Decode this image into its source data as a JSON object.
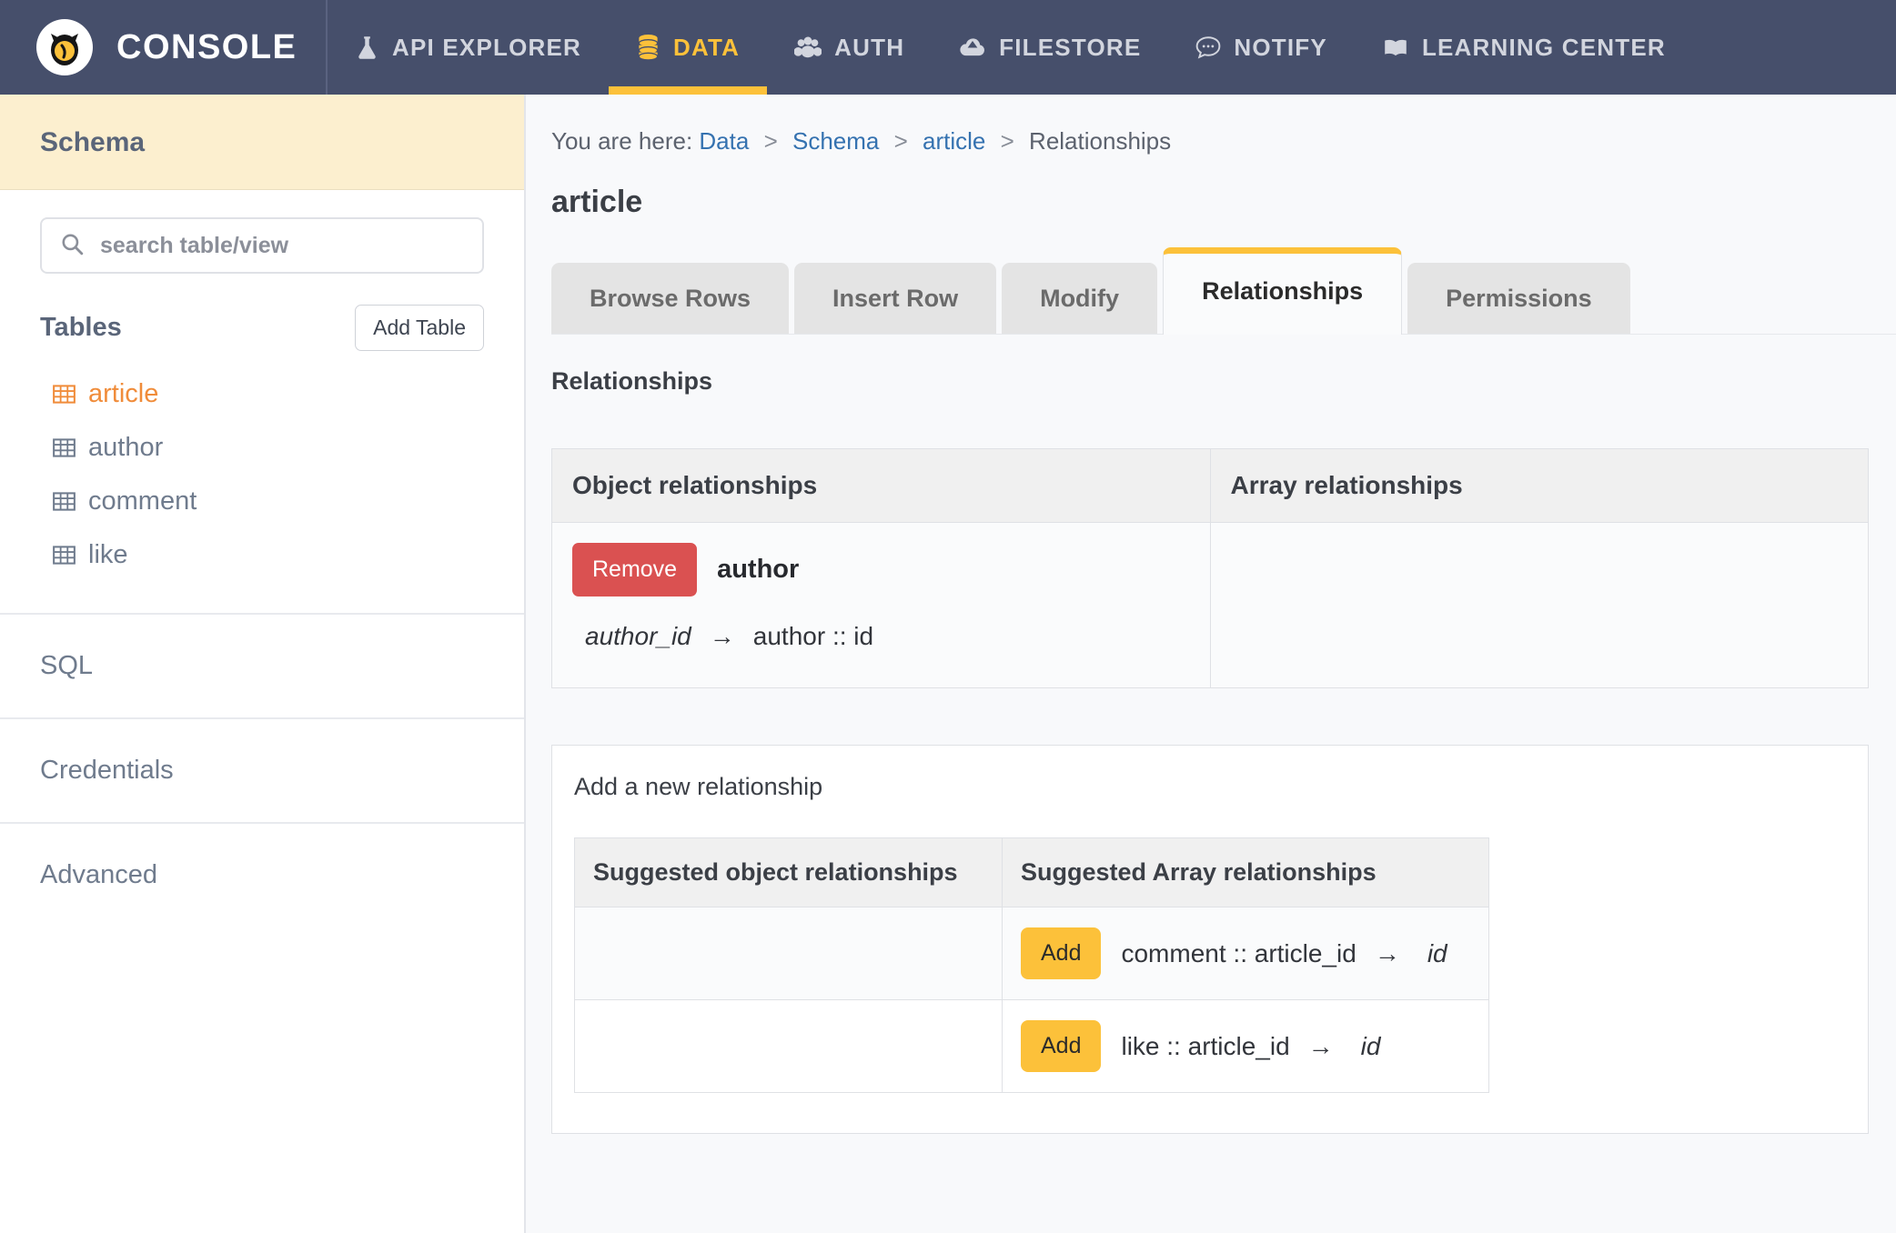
{
  "topnav": {
    "brand": "CONSOLE",
    "logo_icon": "owl-logo-icon",
    "items": [
      {
        "label": "API EXPLORER",
        "icon": "flask-icon",
        "active": false
      },
      {
        "label": "DATA",
        "icon": "database-icon",
        "active": true
      },
      {
        "label": "AUTH",
        "icon": "users-icon",
        "active": false
      },
      {
        "label": "FILESTORE",
        "icon": "cloud-upload-icon",
        "active": false
      },
      {
        "label": "NOTIFY",
        "icon": "chat-bubble-icon",
        "active": false
      },
      {
        "label": "LEARNING CENTER",
        "icon": "book-icon",
        "active": false
      }
    ],
    "accent_color": "#fcc13a",
    "background_color": "#464f6b"
  },
  "sidebar": {
    "header_title": "Schema",
    "search": {
      "placeholder": "search table/view",
      "value": "",
      "icon": "search-icon"
    },
    "tables_label": "Tables",
    "add_table_label": "Add Table",
    "tables": [
      {
        "name": "article",
        "icon": "table-grid-icon",
        "selected": true
      },
      {
        "name": "author",
        "icon": "table-grid-icon",
        "selected": false
      },
      {
        "name": "comment",
        "icon": "table-grid-icon",
        "selected": false
      },
      {
        "name": "like",
        "icon": "table-grid-icon",
        "selected": false
      }
    ],
    "sections": [
      {
        "label": "SQL"
      },
      {
        "label": "Credentials"
      },
      {
        "label": "Advanced"
      }
    ],
    "selected_color": "#f08c3a"
  },
  "main": {
    "breadcrumb": {
      "prefix": "You are here:",
      "items": [
        {
          "label": "Data",
          "link": true
        },
        {
          "label": "Schema",
          "link": true
        },
        {
          "label": "article",
          "link": true
        },
        {
          "label": "Relationships",
          "link": false
        }
      ],
      "separator": ">"
    },
    "page_title": "article",
    "tabs": [
      {
        "label": "Browse Rows",
        "active": false
      },
      {
        "label": "Insert Row",
        "active": false
      },
      {
        "label": "Modify",
        "active": false
      },
      {
        "label": "Relationships",
        "active": true
      },
      {
        "label": "Permissions",
        "active": false
      }
    ],
    "section_title": "Relationships",
    "relationships_table": {
      "headers": [
        "Object relationships",
        "Array relationships"
      ],
      "object_relationships": [
        {
          "remove_label": "Remove",
          "name": "author",
          "source_column": "author_id",
          "arrow": "→",
          "target": "author :: id"
        }
      ],
      "array_relationships": []
    },
    "add_new": {
      "title": "Add a new relationship",
      "headers": [
        "Suggested object relationships",
        "Suggested Array relationships"
      ],
      "rows": [
        {
          "object": null,
          "array": {
            "add_label": "Add",
            "source": "comment :: article_id",
            "arrow": "→",
            "target": "id"
          }
        },
        {
          "object": null,
          "array": {
            "add_label": "Add",
            "source": "like :: article_id",
            "arrow": "→",
            "target": "id"
          }
        }
      ]
    }
  }
}
